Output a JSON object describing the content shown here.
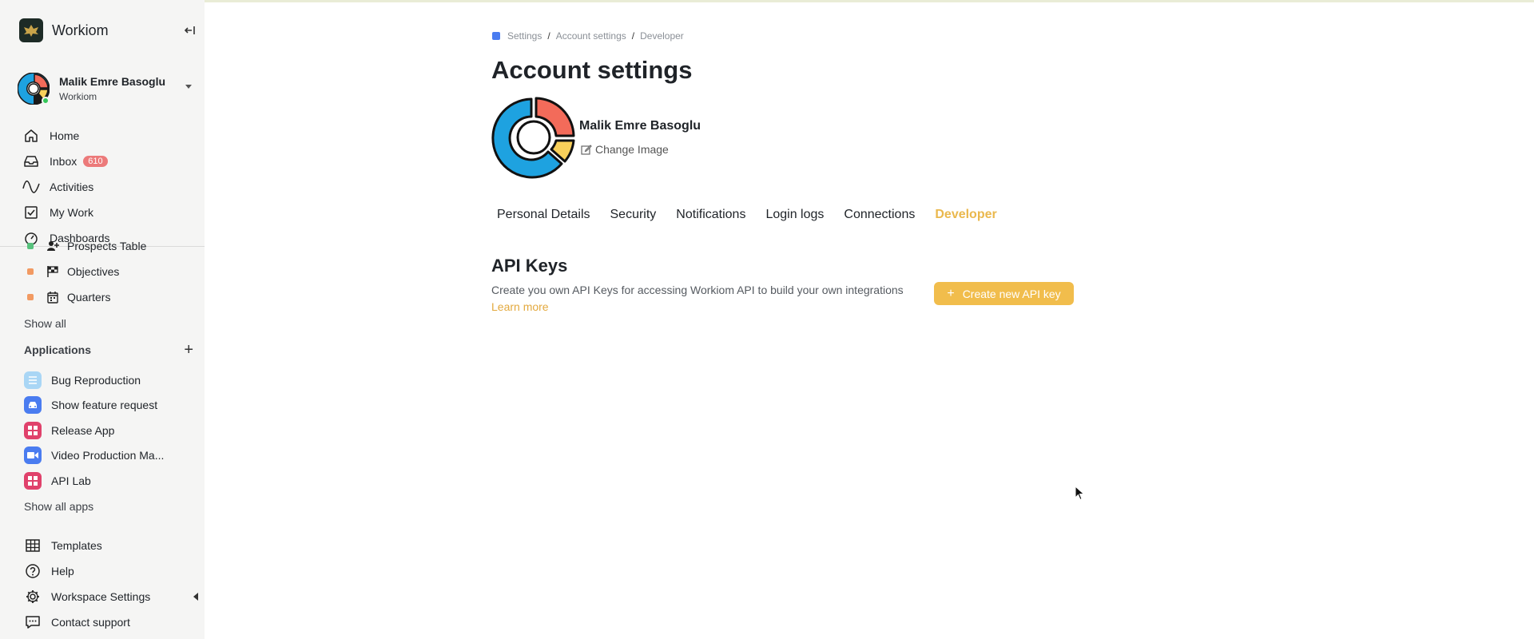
{
  "workspace": {
    "name": "Workiom"
  },
  "user": {
    "name": "Malik Emre Basoglu",
    "workspace": "Workiom"
  },
  "nav": [
    {
      "label": "Home",
      "icon": "home-icon"
    },
    {
      "label": "Inbox",
      "icon": "inbox-icon",
      "badge": "610"
    },
    {
      "label": "Activities",
      "icon": "activity-icon"
    },
    {
      "label": "My Work",
      "icon": "checkbox-icon"
    },
    {
      "label": "Dashboards",
      "icon": "dashboard-icon"
    }
  ],
  "favorites": [
    {
      "label": "Prospects Table",
      "icon": "user-plus-icon",
      "color": "#58c27d"
    },
    {
      "label": "Objectives",
      "icon": "flag-icon",
      "color": "#f29a62"
    },
    {
      "label": "Quarters",
      "icon": "calendar-icon",
      "color": "#f29a62"
    }
  ],
  "favorites_show_all": "Show all",
  "applications": {
    "heading": "Applications",
    "items": [
      {
        "label": "Bug Reproduction",
        "icon": "list-icon",
        "color": "#a9d6f5"
      },
      {
        "label": "Show feature request",
        "icon": "car-icon",
        "color": "#4a7cf0"
      },
      {
        "label": "Release App",
        "icon": "grid-icon",
        "color": "#e0416b"
      },
      {
        "label": "Video Production Ma...",
        "icon": "video-icon",
        "color": "#4a7cf0"
      },
      {
        "label": "API Lab",
        "icon": "grid-icon",
        "color": "#e0416b"
      }
    ],
    "show_all": "Show all apps"
  },
  "bottom_nav": [
    {
      "label": "Templates",
      "icon": "table-icon"
    },
    {
      "label": "Help",
      "icon": "help-icon"
    },
    {
      "label": "Workspace Settings",
      "icon": "gear-icon"
    },
    {
      "label": "Contact support",
      "icon": "chat-icon"
    }
  ],
  "breadcrumb": [
    "Settings",
    "Account settings",
    "Developer"
  ],
  "page_title": "Account settings",
  "profile": {
    "name": "Malik Emre Basoglu",
    "change_image": "Change Image"
  },
  "tabs": [
    {
      "label": "Personal Details",
      "active": false
    },
    {
      "label": "Security",
      "active": false
    },
    {
      "label": "Notifications",
      "active": false
    },
    {
      "label": "Login logs",
      "active": false
    },
    {
      "label": "Connections",
      "active": false
    },
    {
      "label": "Developer",
      "active": true
    }
  ],
  "api_keys": {
    "title": "API Keys",
    "description": "Create you own API Keys for accessing Workiom API to build your own integrations",
    "learn_more": "Learn more",
    "create_button": "Create new API key"
  },
  "colors": {
    "accent": "#f1bd4c",
    "active_tab": "#eab84d",
    "badge": "#ec7a7a",
    "breadcrumb_square": "#4a7cf0"
  }
}
